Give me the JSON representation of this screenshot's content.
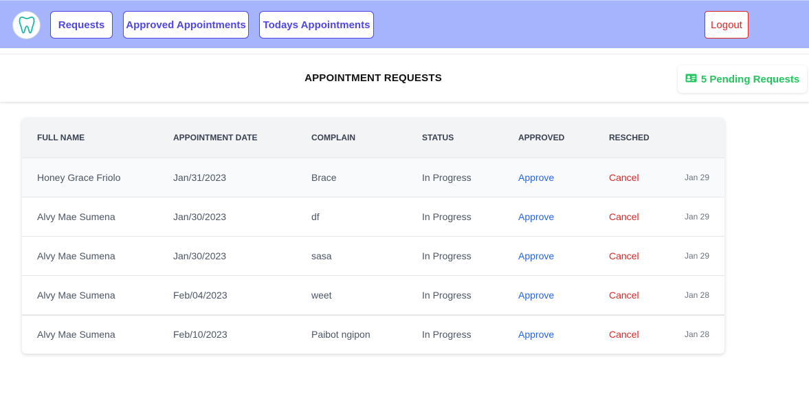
{
  "navbar": {
    "logo": {
      "icon": "tooth-icon",
      "color": "#14b8a6"
    },
    "buttons": [
      {
        "label": "Requests"
      },
      {
        "label": "Approved Appointments"
      },
      {
        "label": "Todays Appointments"
      }
    ],
    "logout_label": "Logout",
    "background": "#a5b4fc",
    "accent": "#4f46e5"
  },
  "header": {
    "title": "APPOINTMENT REQUESTS",
    "pending": {
      "icon": "id-card-icon",
      "label": "5 Pending Requests",
      "color": "#22c55e"
    }
  },
  "table": {
    "columns": [
      "FULL NAME",
      "APPOINTMENT DATE",
      "COMPLAIN",
      "STATUS",
      "APPROVED",
      "RESCHED"
    ],
    "rows": [
      {
        "name": "Honey Grace Friolo",
        "date": "Jan/31/2023",
        "complain": "Brace",
        "status": "In Progress",
        "approve": "Approve",
        "cancel": "Cancel",
        "created": "Jan 29"
      },
      {
        "name": "Alvy Mae Sumena",
        "date": "Jan/30/2023",
        "complain": "df",
        "status": "In Progress",
        "approve": "Approve",
        "cancel": "Cancel",
        "created": "Jan 29"
      },
      {
        "name": "Alvy Mae Sumena",
        "date": "Jan/30/2023",
        "complain": "sasa",
        "status": "In Progress",
        "approve": "Approve",
        "cancel": "Cancel",
        "created": "Jan 29"
      },
      {
        "name": "Alvy Mae Sumena",
        "date": "Feb/04/2023",
        "complain": "weet",
        "status": "In Progress",
        "approve": "Approve",
        "cancel": "Cancel",
        "created": "Jan 28"
      },
      {
        "name": "Alvy Mae Sumena",
        "date": "Feb/10/2023",
        "complain": "Paibot ngipon",
        "status": "In Progress",
        "approve": "Approve",
        "cancel": "Cancel",
        "created": "Jan 28"
      }
    ],
    "approve_color": "#2563eb",
    "cancel_color": "#dc2626"
  }
}
